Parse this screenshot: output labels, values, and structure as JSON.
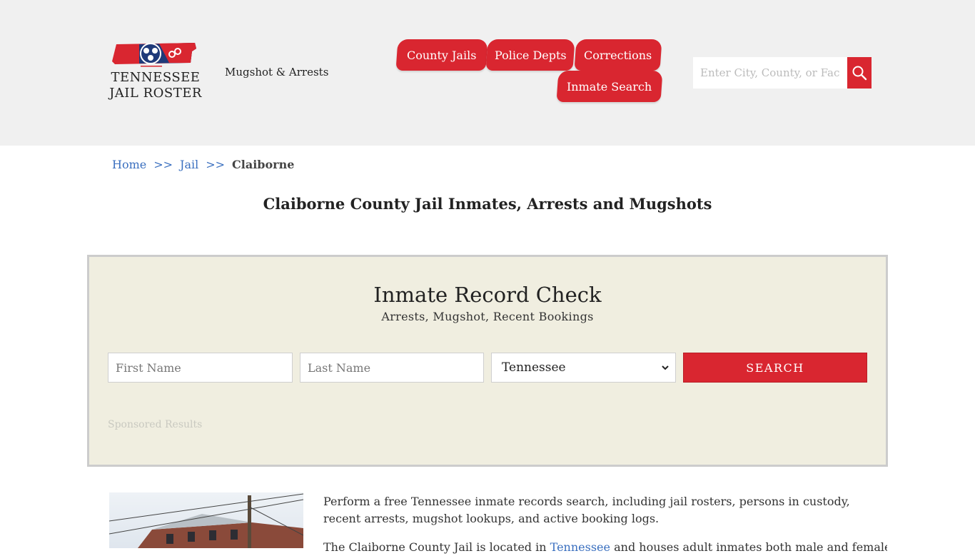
{
  "header": {
    "logo_line1": "TENNESSEE",
    "logo_line2": "JAIL ROSTER",
    "tagline": "Mugshot & Arrests",
    "nav": {
      "county_jails": "County Jails",
      "police_depts": "Police Depts",
      "corrections": "Corrections",
      "inmate_search": "Inmate Search"
    },
    "search_placeholder": "Enter City, County, or Facility",
    "search_icon": "magnifier-icon"
  },
  "breadcrumb": {
    "home": "Home",
    "sep": ">>",
    "jail": "Jail",
    "current": "Claiborne"
  },
  "page_title": "Claiborne County Jail Inmates, Arrests and Mugshots",
  "record_check": {
    "title": "Inmate Record Check",
    "subtitle": "Arrests, Mugshot, Recent Bookings",
    "first_name_placeholder": "First Name",
    "last_name_placeholder": "Last Name",
    "state_selected": "Tennessee",
    "search_label": "SEARCH",
    "sponsored": "Sponsored Results"
  },
  "content": {
    "paragraph1": "Perform a free Tennessee inmate records search, including jail rosters, persons in custody, recent arrests, mugshot lookups, and active booking logs.",
    "paragraph2_start": "The Claiborne County Jail is located in",
    "paragraph2_link": "Tennessee",
    "paragraph2_end": "and houses adult inmates both male and female wh"
  },
  "colors": {
    "accent_red": "#d92630",
    "header_bg": "#f0f0f0",
    "panel_bg": "#f0eee0",
    "link_blue": "#3a6fbf"
  }
}
